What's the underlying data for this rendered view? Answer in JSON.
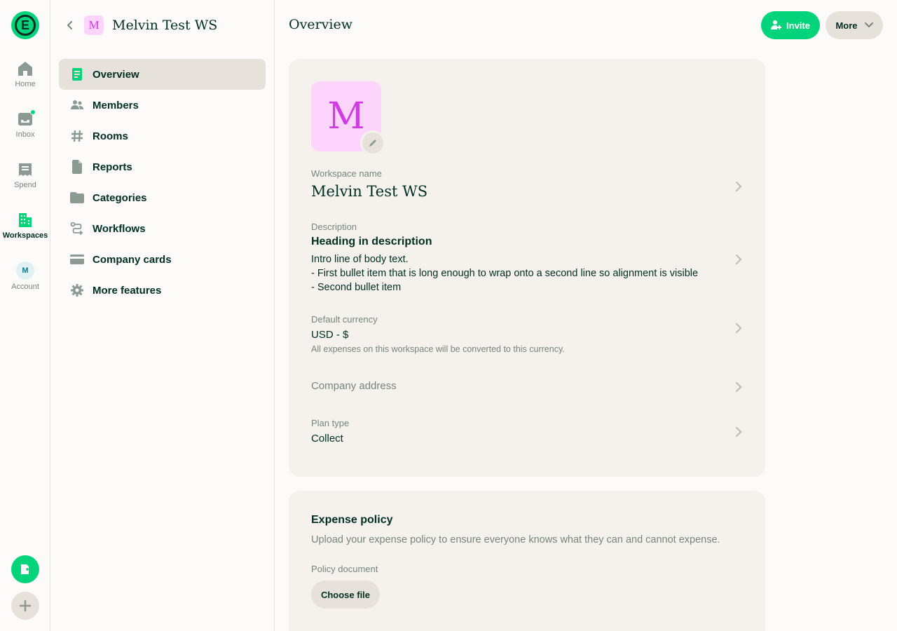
{
  "rail": {
    "logo_letter": "E",
    "items": [
      {
        "label": "Home",
        "icon": "home-icon"
      },
      {
        "label": "Inbox",
        "icon": "inbox-icon"
      },
      {
        "label": "Spend",
        "icon": "receipt-icon"
      },
      {
        "label": "Workspaces",
        "icon": "building-icon"
      },
      {
        "label": "Account",
        "icon": "avatar"
      }
    ],
    "account_initial": "M",
    "colors": {
      "accent": "#03d47c",
      "text": "#002e22",
      "muted": "#76847e"
    }
  },
  "sidebar": {
    "workspace_initial": "M",
    "workspace_name": "Melvin Test WS",
    "items": [
      {
        "label": "Overview",
        "icon": "document-icon"
      },
      {
        "label": "Members",
        "icon": "users-icon"
      },
      {
        "label": "Rooms",
        "icon": "hashtag-icon"
      },
      {
        "label": "Reports",
        "icon": "file-icon"
      },
      {
        "label": "Categories",
        "icon": "folder-icon"
      },
      {
        "label": "Workflows",
        "icon": "workflow-icon"
      },
      {
        "label": "Company cards",
        "icon": "card-icon"
      },
      {
        "label": "More features",
        "icon": "gear-icon"
      }
    ]
  },
  "header": {
    "title": "Overview",
    "invite_label": "Invite",
    "more_label": "More"
  },
  "overview": {
    "avatar_initial": "M",
    "workspace_name_label": "Workspace name",
    "workspace_name": "Melvin Test WS",
    "description_label": "Description",
    "description_heading": "Heading in description",
    "description_lines": [
      "Intro line of body text.",
      "- First bullet item that is long enough to wrap onto a second line so alignment is visible",
      "- Second bullet item"
    ],
    "currency_label": "Default currency",
    "currency_value": "USD - $",
    "currency_hint": "All expenses on this workspace will be converted to this currency.",
    "address_placeholder": "Company address",
    "plan_label": "Plan type",
    "plan_value": "Collect"
  },
  "expense_policy": {
    "title": "Expense policy",
    "subtitle": "Upload your expense policy to ensure everyone knows what they can and cannot expense.",
    "document_label": "Policy document",
    "choose_label": "Choose file"
  }
}
